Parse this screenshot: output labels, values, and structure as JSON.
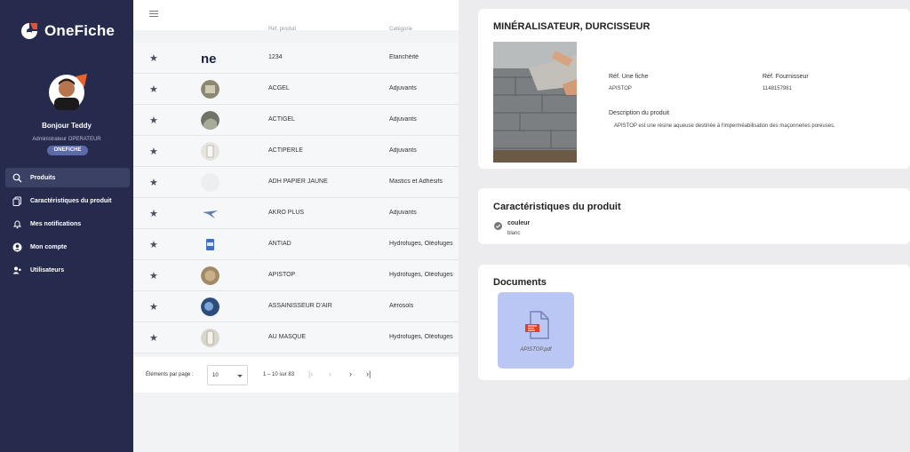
{
  "app": {
    "logo_text": "OneFiche"
  },
  "user": {
    "greeting": "Bonjour Teddy",
    "role": "Administrateur OPERATEUR",
    "badge": "ONEFICHE"
  },
  "nav": [
    {
      "label": "Produits",
      "icon": "search-icon",
      "active": true
    },
    {
      "label": "Caractéristiques du produit",
      "icon": "copy-icon"
    },
    {
      "label": "Mes notifications",
      "icon": "bell-icon"
    },
    {
      "label": "Mon compte",
      "icon": "account-icon"
    },
    {
      "label": "Utilisateurs",
      "icon": "users-icon"
    }
  ],
  "table": {
    "headers": {
      "ref": "Réf. produit",
      "cat": "Catégorie"
    },
    "rows": [
      {
        "ref": "1234",
        "cat": "Étanchéité",
        "thumb": "logo-ne"
      },
      {
        "ref": "ACGEL",
        "cat": "Adjuvants",
        "thumb": "photo"
      },
      {
        "ref": "ACTIGEL",
        "cat": "Adjuvants",
        "thumb": "photo"
      },
      {
        "ref": "ACTIPERLE",
        "cat": "Adjuvants",
        "thumb": "photo"
      },
      {
        "ref": "ADH PAPIER JAUNE",
        "cat": "Mastics et Adhésifs",
        "thumb": "blank"
      },
      {
        "ref": "AKRO PLUS",
        "cat": "Adjuvants",
        "thumb": "photo"
      },
      {
        "ref": "ANTIAD",
        "cat": "Hydrofuges, Oléofuges",
        "thumb": "photo"
      },
      {
        "ref": "APISTOP",
        "cat": "Hydrofuges, Oléofuges",
        "thumb": "photo"
      },
      {
        "ref": "ASSAINISSEUR D'AIR",
        "cat": "Aérosols",
        "thumb": "photo"
      },
      {
        "ref": "AU MASQUE",
        "cat": "Hydrofuges, Oléofuges",
        "thumb": "photo"
      }
    ]
  },
  "pager": {
    "label": "Éléments par page :",
    "per_page": "10",
    "range": "1 – 10 sur 83"
  },
  "detail": {
    "title": "MINÉRALISATEUR, DURCISSEUR",
    "ref_fiche_label": "Réf. Une fiche",
    "ref_fiche_value": "APISTOP",
    "ref_fournisseur_label": "Réf. Fournisseur",
    "ref_fournisseur_value": "1148157981",
    "desc_label": "Description du produit",
    "desc_value": "APISTOP est une résine aqueuse destinée à l'imperméabilisation des maçonneries poreuses.",
    "carac_title": "Caractéristiques du produit",
    "carac_name": "couleur",
    "carac_value": "blanc",
    "docs_title": "Documents",
    "doc_name": "APISTOP.pdf"
  },
  "colors": {
    "sidebar": "#262b4d",
    "accent": "#5b6aa8",
    "doc_tile": "#bac7f4"
  }
}
